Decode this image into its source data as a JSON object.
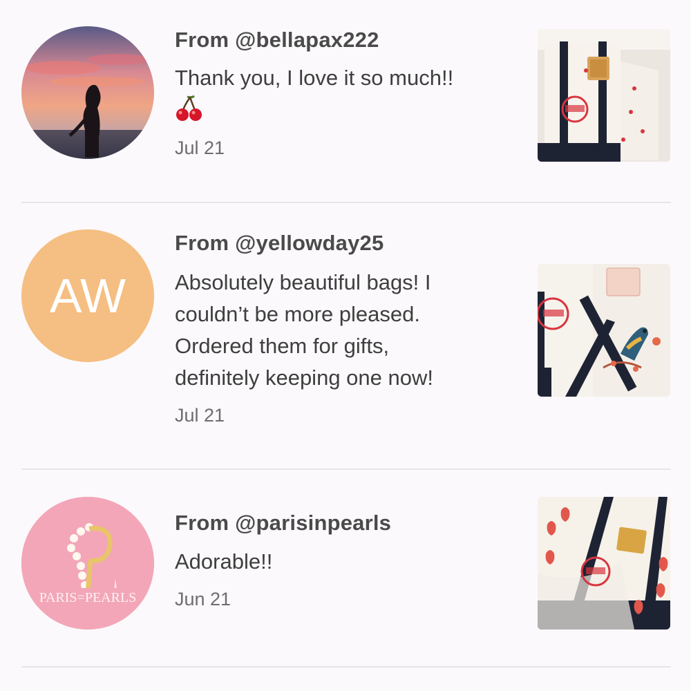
{
  "reviews": [
    {
      "avatar": {
        "type": "photo",
        "icon": "sunset-silhouette-avatar"
      },
      "username": "From @bellapax222",
      "comment": "Thank you, I love it so much!!",
      "emoji": "cherry",
      "date": "Jul 21",
      "thumbnail": {
        "icon": "tote-bag-cherries-photo"
      }
    },
    {
      "avatar": {
        "type": "initials",
        "initials": "AW",
        "color": "#f5be82"
      },
      "username": "From @yellowday25",
      "comment_lines": [
        "Absolutely beautiful bags! I",
        "couldn’t be more pleased.",
        "Ordered them for gifts,",
        "definitely keeping one now!"
      ],
      "date": "Jul 21",
      "thumbnail": {
        "icon": "tote-bag-bird-photo"
      }
    },
    {
      "avatar": {
        "type": "logo",
        "icon": "paris-pearls-logo",
        "logo_text": "PARIS=PEARLS",
        "color": "#f3a6b8"
      },
      "username": "From @parisinpearls",
      "comment": "Adorable!!",
      "date": "Jun 21",
      "thumbnail": {
        "icon": "tote-bag-strawberries-photo"
      }
    }
  ],
  "colors": {
    "background": "#fbf9fb",
    "divider": "#e8e5e8",
    "tote_navy": "#1e2334",
    "trader_joes_red": "#d8343f"
  }
}
